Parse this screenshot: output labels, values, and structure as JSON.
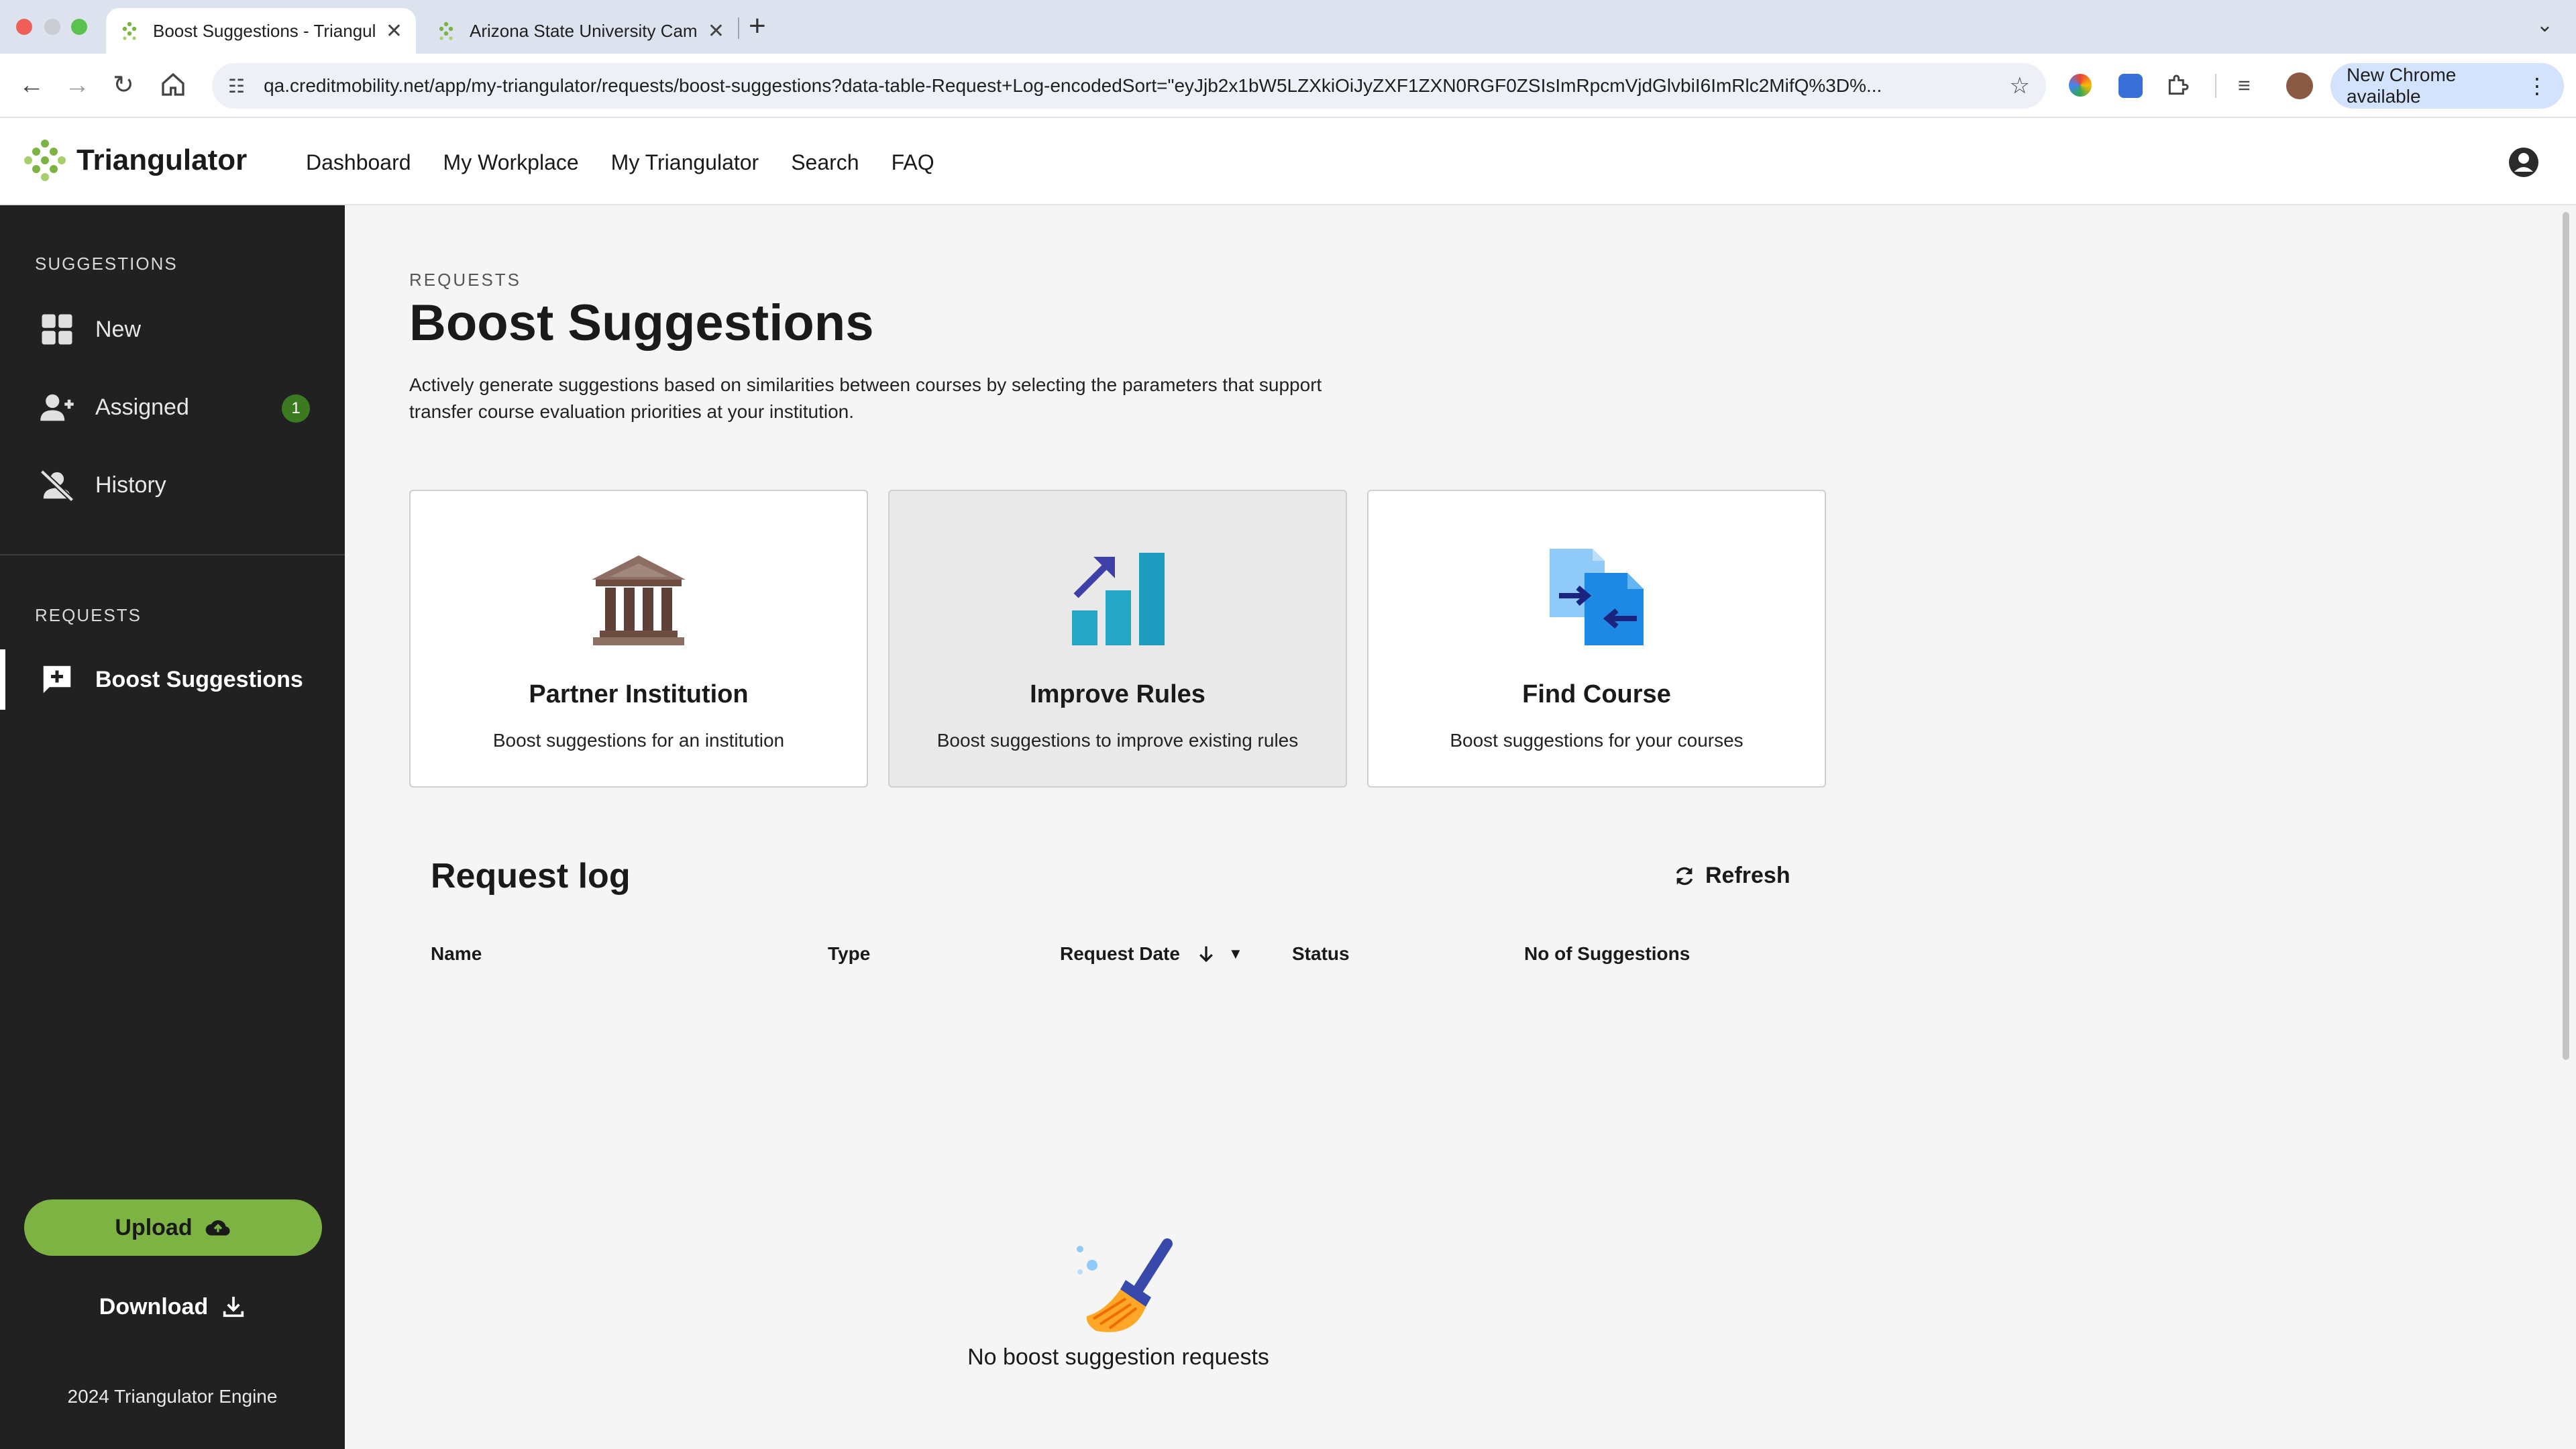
{
  "browser": {
    "tabs": [
      {
        "title": "Boost Suggestions - Triangulator",
        "active": true
      },
      {
        "title": "Arizona State University Campus",
        "active": false
      }
    ],
    "url": "qa.creditmobility.net/app/my-triangulator/requests/boost-suggestions?data-table-Request+Log-encodedSort=\"eyJjb2x1bW5LZXkiOiJyZXF1ZXN0RGF0ZSIsImRpcmVjdGlvbiI6ImRlc2MifQ%3D%...",
    "update_label": "New Chrome available"
  },
  "header": {
    "brand": "Triangulator",
    "nav": [
      "Dashboard",
      "My Workplace",
      "My Triangulator",
      "Search",
      "FAQ"
    ]
  },
  "sidebar": {
    "suggestions_heading": "SUGGESTIONS",
    "suggestions": [
      {
        "label": "New",
        "icon": "grid-icon"
      },
      {
        "label": "Assigned",
        "icon": "person-add-icon",
        "badge": "1"
      },
      {
        "label": "History",
        "icon": "person-off-icon"
      }
    ],
    "requests_heading": "REQUESTS",
    "requests": [
      {
        "label": "Boost Suggestions",
        "icon": "add-comment-icon",
        "active": true
      }
    ],
    "upload_label": "Upload",
    "download_label": "Download",
    "copyright": "2024 Triangulator Engine"
  },
  "main": {
    "eyebrow": "REQUESTS",
    "title": "Boost Suggestions",
    "description": "Actively generate suggestions based on similarities between courses by selecting the parameters that support transfer course evaluation priorities at your institution.",
    "cards": [
      {
        "title": "Partner Institution",
        "description": "Boost suggestions for an institution",
        "icon": "institution-icon"
      },
      {
        "title": "Improve Rules",
        "description": "Boost suggestions to improve existing rules",
        "icon": "bar-chart-up-icon"
      },
      {
        "title": "Find Course",
        "description": "Boost suggestions for your courses",
        "icon": "swap-documents-icon"
      }
    ],
    "request_log": {
      "title": "Request log",
      "refresh_label": "Refresh",
      "columns": [
        "Name",
        "Type",
        "Request Date",
        "Status",
        "No of Suggestions"
      ],
      "rows": [],
      "empty_message": "No boost suggestion requests"
    }
  },
  "colors": {
    "sidebar_bg": "#212121",
    "accent_green": "#7cb342",
    "badge_green": "#3c7a22",
    "main_bg": "#f5f5f5"
  }
}
